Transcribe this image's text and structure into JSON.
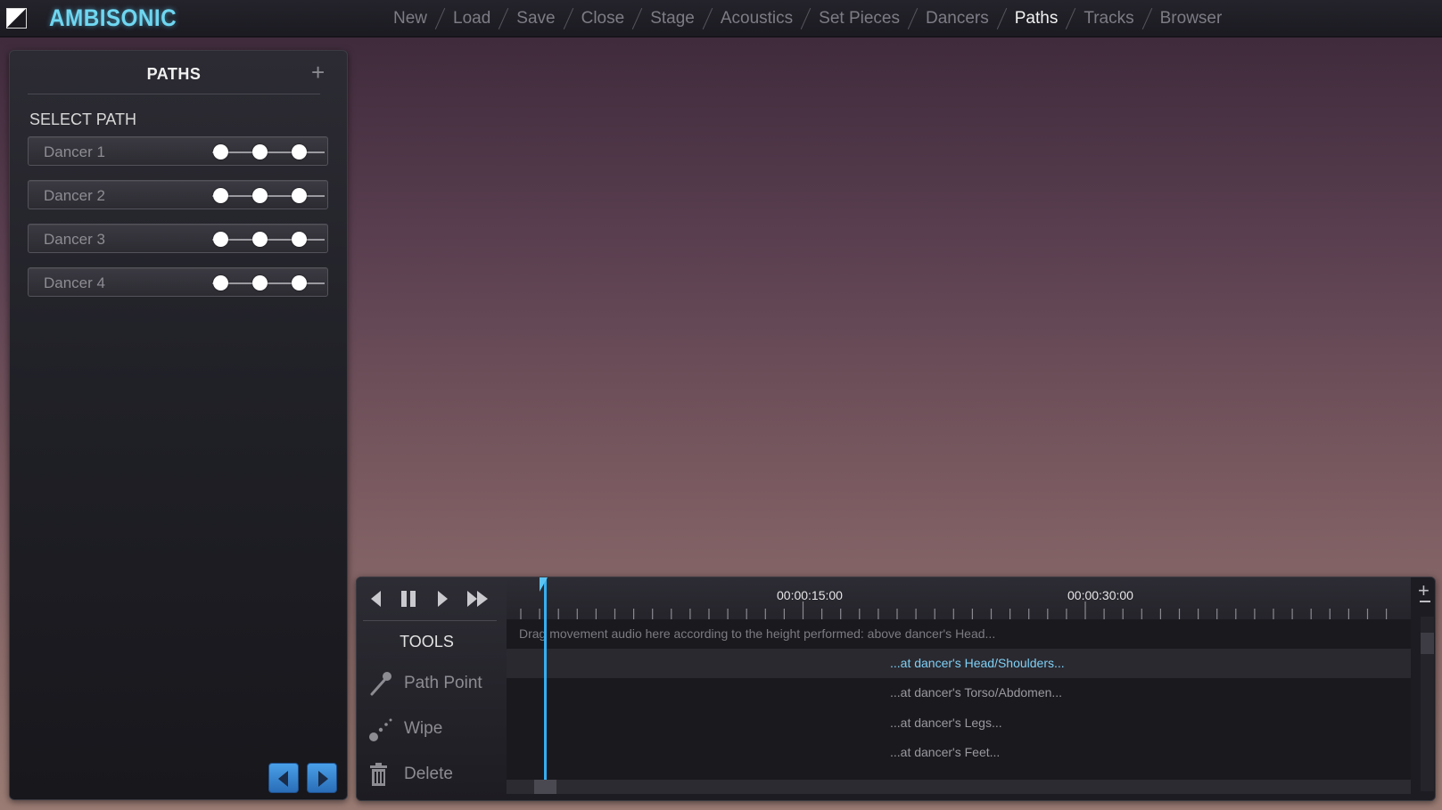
{
  "app": {
    "title": "AMBISONIC",
    "accent": "#6fd6f0"
  },
  "nav": {
    "items": [
      {
        "label": "New",
        "active": false
      },
      {
        "label": "Load",
        "active": false
      },
      {
        "label": "Save",
        "active": false
      },
      {
        "label": "Close",
        "active": false
      },
      {
        "label": "Stage",
        "active": false
      },
      {
        "label": "Acoustics",
        "active": false
      },
      {
        "label": "Set Pieces",
        "active": false
      },
      {
        "label": "Dancers",
        "active": false
      },
      {
        "label": "Paths",
        "active": true
      },
      {
        "label": "Tracks",
        "active": false
      },
      {
        "label": "Browser",
        "active": false
      }
    ]
  },
  "paths_panel": {
    "title": "PATHS",
    "add_icon": "plus-icon",
    "select_label": "SELECT PATH",
    "dancers": [
      {
        "name": "Dancer 1"
      },
      {
        "name": "Dancer 2"
      },
      {
        "name": "Dancer 3"
      },
      {
        "name": "Dancer 4"
      }
    ],
    "prev_icon": "arrow-left-icon",
    "next_icon": "arrow-right-icon"
  },
  "transport": {
    "buttons": [
      "rewind-icon",
      "pause-icon",
      "play-icon",
      "fast-forward-icon"
    ]
  },
  "tools": {
    "label": "TOOLS",
    "items": [
      {
        "label": "Path Point",
        "icon": "pen-icon"
      },
      {
        "label": "Wipe",
        "icon": "wipe-icon"
      },
      {
        "label": "Delete",
        "icon": "trash-icon"
      }
    ]
  },
  "timeline": {
    "time_labels": [
      "00:00:15:00",
      "00:00:30:00"
    ],
    "hint": "Drag movement audio here according to the height performed: above dancer's Head...",
    "tracks": [
      {
        "label": "...at dancer's Head/Shoulders...",
        "highlight": true
      },
      {
        "label": "...at dancer's Torso/Abdomen...",
        "highlight": false
      },
      {
        "label": "...at dancer's Legs...",
        "highlight": false
      },
      {
        "label": "...at dancer's Feet...",
        "highlight": false
      }
    ],
    "playhead_color": "#35aef0"
  }
}
